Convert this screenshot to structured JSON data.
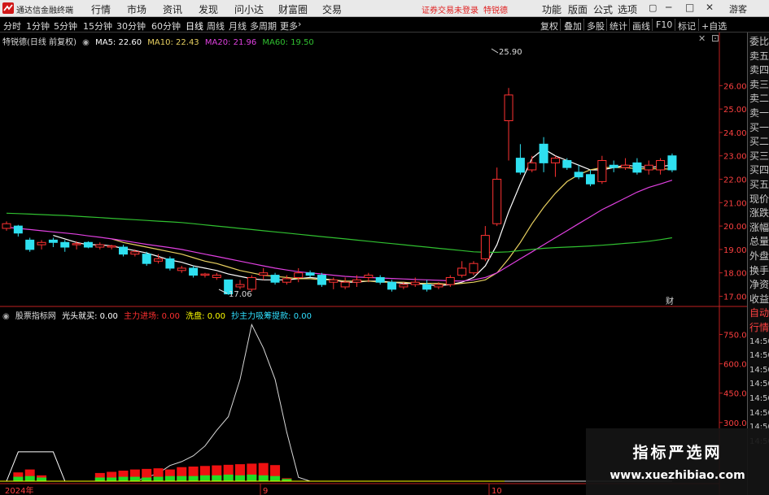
{
  "app": {
    "title": "通达信金融终端",
    "menu": [
      "行情",
      "市场",
      "资讯",
      "发现",
      "问小达",
      "财富圈",
      "交易"
    ],
    "notice": "证券交易未登录",
    "stock_tag": "特锐德",
    "right_menu": [
      "功能",
      "版面",
      "公式",
      "选项"
    ],
    "guest": "游客"
  },
  "toolbar": {
    "periods": [
      "分时",
      "1分钟",
      "5分钟",
      "15分钟",
      "30分钟",
      "60分钟",
      "日线",
      "周线",
      "月线",
      "多周期",
      "更多"
    ],
    "active_period": "日线",
    "right_buttons": [
      "复权",
      "叠加",
      "多股",
      "统计",
      "画线",
      "F10",
      "标记",
      "+自选"
    ]
  },
  "main_legend": {
    "stock": "特锐德(日线 前复权)",
    "ma5": "MA5: 22.60",
    "ma10": "MA10: 22.43",
    "ma20": "MA20: 21.96",
    "ma60": "MA60: 19.50"
  },
  "colors": {
    "up": "#ff3232",
    "down": "#2fe0f0",
    "ma5": "#ffffff",
    "ma10": "#e8d060",
    "ma20": "#e040e0",
    "ma60": "#30c030",
    "axis": "#c02020"
  },
  "price_axis": {
    "ticks": [
      "26.00",
      "25.00",
      "24.00",
      "23.00",
      "22.00",
      "21.00",
      "20.00",
      "19.00",
      "18.00",
      "17.00"
    ]
  },
  "annotations": {
    "high": "25.90",
    "low": "17.06",
    "cai": "财"
  },
  "indicator": {
    "name": "股票指标网",
    "items": [
      {
        "label": "光头就买: 0.00",
        "color": "#ffffff"
      },
      {
        "label": "主力进场: 0.00",
        "color": "#ff3030"
      },
      {
        "label": "洗盘: 0.00",
        "color": "#ffff00"
      },
      {
        "label": "抄主力吸筹提款: 0.00",
        "color": "#30e0ff"
      }
    ],
    "ticks": [
      "750.00",
      "600.00",
      "450.00",
      "300.00"
    ]
  },
  "date_axis": [
    "2024年",
    "9",
    "10"
  ],
  "side_panel": [
    "委比",
    "卖五",
    "卖四",
    "卖三",
    "卖二",
    "卖一",
    "买一",
    "买二",
    "买三",
    "买四",
    "买五",
    "现价",
    "涨跌",
    "涨幅",
    "总量",
    "外盘",
    "换手",
    "净资",
    "收益",
    "自动",
    "行情",
    "14:50",
    "14:50",
    "14:50",
    "14:50",
    "14:50",
    "14:50",
    "14:50",
    "14:50"
  ],
  "chart_data": [
    {
      "type": "candlestick",
      "title": "特锐德(日线 前复权)",
      "ylim": [
        16.6,
        28.2
      ],
      "candles": [
        {
          "o": 19.9,
          "c": 20.1,
          "h": 20.2,
          "l": 19.8
        },
        {
          "o": 20.0,
          "c": 19.7,
          "h": 20.05,
          "l": 19.55
        },
        {
          "o": 19.4,
          "c": 19.0,
          "h": 19.5,
          "l": 18.9
        },
        {
          "o": 19.2,
          "c": 19.3,
          "h": 19.4,
          "l": 19.0
        },
        {
          "o": 19.4,
          "c": 19.3,
          "h": 19.5,
          "l": 19.1
        },
        {
          "o": 19.3,
          "c": 19.1,
          "h": 19.4,
          "l": 18.9
        },
        {
          "o": 19.2,
          "c": 19.25,
          "h": 19.35,
          "l": 19.0
        },
        {
          "o": 19.3,
          "c": 19.1,
          "h": 19.35,
          "l": 19.05
        },
        {
          "o": 19.1,
          "c": 19.2,
          "h": 19.3,
          "l": 19.0
        },
        {
          "o": 19.1,
          "c": 19.15,
          "h": 19.2,
          "l": 19.0
        },
        {
          "o": 19.1,
          "c": 18.8,
          "h": 19.2,
          "l": 18.7
        },
        {
          "o": 18.8,
          "c": 18.9,
          "h": 19.0,
          "l": 18.7
        },
        {
          "o": 18.8,
          "c": 18.4,
          "h": 18.9,
          "l": 18.3
        },
        {
          "o": 18.5,
          "c": 18.6,
          "h": 18.8,
          "l": 18.4
        },
        {
          "o": 18.6,
          "c": 18.2,
          "h": 18.7,
          "l": 18.1
        },
        {
          "o": 18.1,
          "c": 18.2,
          "h": 18.3,
          "l": 18.0
        },
        {
          "o": 18.2,
          "c": 17.9,
          "h": 18.3,
          "l": 17.8
        },
        {
          "o": 17.9,
          "c": 17.95,
          "h": 18.0,
          "l": 17.8
        },
        {
          "o": 17.8,
          "c": 17.9,
          "h": 18.0,
          "l": 17.7
        },
        {
          "o": 17.7,
          "c": 17.1,
          "h": 17.7,
          "l": 17.06
        },
        {
          "o": 17.4,
          "c": 17.5,
          "h": 17.7,
          "l": 17.3
        },
        {
          "o": 17.3,
          "c": 17.8,
          "h": 17.9,
          "l": 17.2
        },
        {
          "o": 17.9,
          "c": 18.0,
          "h": 18.2,
          "l": 17.7
        },
        {
          "o": 17.9,
          "c": 17.6,
          "h": 18.0,
          "l": 17.5
        },
        {
          "o": 17.6,
          "c": 17.75,
          "h": 17.9,
          "l": 17.5
        },
        {
          "o": 17.8,
          "c": 18.0,
          "h": 18.2,
          "l": 17.6
        },
        {
          "o": 18.0,
          "c": 17.9,
          "h": 18.1,
          "l": 17.8
        },
        {
          "o": 17.9,
          "c": 17.5,
          "h": 18.0,
          "l": 17.4
        },
        {
          "o": 17.6,
          "c": 17.7,
          "h": 17.8,
          "l": 17.3
        },
        {
          "o": 17.4,
          "c": 17.6,
          "h": 17.8,
          "l": 17.3
        },
        {
          "o": 17.6,
          "c": 17.7,
          "h": 17.9,
          "l": 17.4
        },
        {
          "o": 17.8,
          "c": 17.9,
          "h": 18.0,
          "l": 17.6
        },
        {
          "o": 17.8,
          "c": 17.6,
          "h": 17.9,
          "l": 17.5
        },
        {
          "o": 17.6,
          "c": 17.3,
          "h": 17.7,
          "l": 17.2
        },
        {
          "o": 17.4,
          "c": 17.5,
          "h": 17.6,
          "l": 17.3
        },
        {
          "o": 17.5,
          "c": 17.6,
          "h": 17.8,
          "l": 17.4
        },
        {
          "o": 17.5,
          "c": 17.3,
          "h": 17.7,
          "l": 17.2
        },
        {
          "o": 17.4,
          "c": 17.5,
          "h": 17.6,
          "l": 17.3
        },
        {
          "o": 17.5,
          "c": 17.8,
          "h": 17.9,
          "l": 17.4
        },
        {
          "o": 17.9,
          "c": 18.2,
          "h": 18.5,
          "l": 17.8
        },
        {
          "o": 18.0,
          "c": 18.4,
          "h": 18.5,
          "l": 17.9
        },
        {
          "o": 18.6,
          "c": 19.6,
          "h": 20.0,
          "l": 18.5
        },
        {
          "o": 20.1,
          "c": 22.0,
          "h": 22.5,
          "l": 20.0
        },
        {
          "o": 24.5,
          "c": 25.6,
          "h": 25.9,
          "l": 22.8
        },
        {
          "o": 22.9,
          "c": 22.3,
          "h": 23.5,
          "l": 22.2
        },
        {
          "o": 22.4,
          "c": 22.7,
          "h": 23.0,
          "l": 22.3
        },
        {
          "o": 23.5,
          "c": 22.7,
          "h": 23.8,
          "l": 22.3
        },
        {
          "o": 22.7,
          "c": 22.9,
          "h": 23.0,
          "l": 22.1
        },
        {
          "o": 22.8,
          "c": 22.5,
          "h": 22.9,
          "l": 22.4
        },
        {
          "o": 22.3,
          "c": 22.1,
          "h": 22.6,
          "l": 22.0
        },
        {
          "o": 22.2,
          "c": 21.8,
          "h": 22.4,
          "l": 21.7
        },
        {
          "o": 21.9,
          "c": 22.8,
          "h": 23.0,
          "l": 21.8
        },
        {
          "o": 22.6,
          "c": 22.5,
          "h": 22.8,
          "l": 22.3
        },
        {
          "o": 22.5,
          "c": 22.6,
          "h": 22.9,
          "l": 22.4
        },
        {
          "o": 22.7,
          "c": 22.3,
          "h": 22.9,
          "l": 22.2
        },
        {
          "o": 22.4,
          "c": 22.6,
          "h": 22.8,
          "l": 22.2
        },
        {
          "o": 22.4,
          "c": 22.8,
          "h": 22.9,
          "l": 22.2
        },
        {
          "o": 23.0,
          "c": 22.4,
          "h": 23.1,
          "l": 22.3
        }
      ],
      "series": [
        {
          "name": "MA5",
          "values": [
            null,
            null,
            null,
            null,
            19.6,
            19.45,
            19.3,
            19.2,
            19.2,
            19.15,
            19.05,
            18.95,
            18.85,
            18.7,
            18.55,
            18.45,
            18.3,
            18.2,
            18.1,
            17.95,
            17.85,
            17.75,
            17.7,
            17.7,
            17.7,
            17.75,
            17.8,
            17.75,
            17.7,
            17.6,
            17.6,
            17.65,
            17.65,
            17.6,
            17.55,
            17.55,
            17.5,
            17.45,
            17.5,
            17.6,
            17.8,
            18.3,
            19.2,
            20.6,
            21.8,
            22.9,
            23.3,
            23.0,
            22.8,
            22.6,
            22.4,
            22.4,
            22.5,
            22.6,
            22.55,
            22.5,
            22.55,
            22.6
          ]
        },
        {
          "name": "MA10",
          "values": [
            null,
            null,
            null,
            null,
            null,
            null,
            null,
            null,
            null,
            19.45,
            19.3,
            19.2,
            19.1,
            19.0,
            18.9,
            18.8,
            18.65,
            18.5,
            18.4,
            18.25,
            18.1,
            18.0,
            17.9,
            17.85,
            17.8,
            17.75,
            17.75,
            17.7,
            17.7,
            17.65,
            17.65,
            17.65,
            17.6,
            17.6,
            17.6,
            17.55,
            17.55,
            17.55,
            17.5,
            17.55,
            17.6,
            17.7,
            18.0,
            18.6,
            19.3,
            20.1,
            20.8,
            21.4,
            21.9,
            22.2,
            22.4,
            22.5,
            22.5,
            22.5,
            22.45,
            22.45,
            22.45,
            22.43
          ]
        },
        {
          "name": "MA20",
          "values": [
            19.95,
            19.9,
            19.85,
            19.8,
            19.75,
            19.7,
            19.65,
            19.58,
            19.52,
            19.45,
            19.38,
            19.3,
            19.22,
            19.15,
            19.08,
            19.0,
            18.9,
            18.8,
            18.7,
            18.6,
            18.5,
            18.4,
            18.3,
            18.2,
            18.12,
            18.05,
            18.0,
            17.95,
            17.9,
            17.85,
            17.82,
            17.8,
            17.78,
            17.76,
            17.74,
            17.72,
            17.7,
            17.68,
            17.66,
            17.65,
            17.7,
            17.8,
            18.0,
            18.3,
            18.6,
            18.9,
            19.2,
            19.5,
            19.8,
            20.1,
            20.4,
            20.7,
            20.95,
            21.2,
            21.45,
            21.65,
            21.8,
            21.96
          ]
        },
        {
          "name": "MA60",
          "values": [
            20.55,
            20.53,
            20.51,
            20.49,
            20.47,
            20.45,
            20.42,
            20.39,
            20.36,
            20.33,
            20.3,
            20.27,
            20.24,
            20.21,
            20.18,
            20.15,
            20.1,
            20.05,
            20.0,
            19.95,
            19.9,
            19.85,
            19.8,
            19.75,
            19.7,
            19.65,
            19.6,
            19.55,
            19.5,
            19.45,
            19.4,
            19.35,
            19.3,
            19.25,
            19.2,
            19.15,
            19.1,
            19.05,
            19.0,
            18.95,
            18.9,
            18.88,
            18.88,
            18.9,
            18.95,
            19.0,
            19.05,
            19.08,
            19.1,
            19.12,
            19.15,
            19.18,
            19.22,
            19.26,
            19.3,
            19.35,
            19.42,
            19.5
          ]
        }
      ]
    },
    {
      "type": "line",
      "title": "股票指标网",
      "ylim": [
        0,
        860
      ],
      "series": [
        {
          "name": "光头就买",
          "values": [
            0,
            150,
            150,
            150,
            150,
            0,
            0,
            0,
            0,
            0,
            0,
            0,
            0,
            0,
            0,
            0,
            0,
            0,
            0,
            0,
            0,
            0,
            0,
            0,
            0,
            0,
            0,
            0,
            0,
            0,
            0,
            0,
            0,
            0,
            0,
            0,
            0,
            0,
            0,
            0,
            0,
            0,
            0,
            0,
            0,
            0,
            0,
            0,
            0,
            0,
            0,
            0,
            0,
            0,
            0,
            0,
            0,
            0
          ]
        }
      ]
    }
  ]
}
